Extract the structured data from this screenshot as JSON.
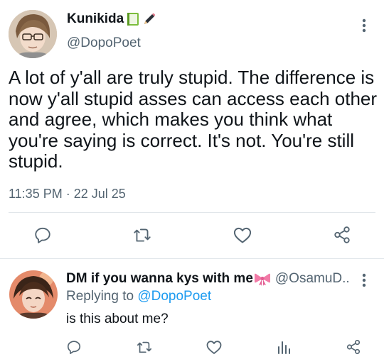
{
  "tweet": {
    "display_name": "Kunikida",
    "handle": "@DopoPoet",
    "text": "A lot of y'all are truly stupid. The difference is now y'all stupid asses can access each other and agree, which makes you think what you're saying is correct. It's not. You're still stupid.",
    "timestamp": "11:35 PM · 22 Jul 25",
    "name_emojis": [
      "green-book-icon",
      "pencil-icon"
    ]
  },
  "actions": [
    "reply-icon",
    "retweet-icon",
    "like-icon",
    "share-icon"
  ],
  "reply": {
    "display_name": "DM if you wanna kys with me",
    "handle": "@OsamuD...",
    "replying_prefix": "Replying to",
    "replying_handle": "@DopoPoet",
    "text": "is this about me?",
    "name_emoji": "ribbon-icon"
  },
  "reply_actions": [
    "reply-icon",
    "retweet-icon",
    "like-icon",
    "analytics-icon",
    "share-icon"
  ],
  "colors": {
    "link": "#1d9bf0",
    "secondary_text": "#536471",
    "divider": "#e1e6ea"
  }
}
